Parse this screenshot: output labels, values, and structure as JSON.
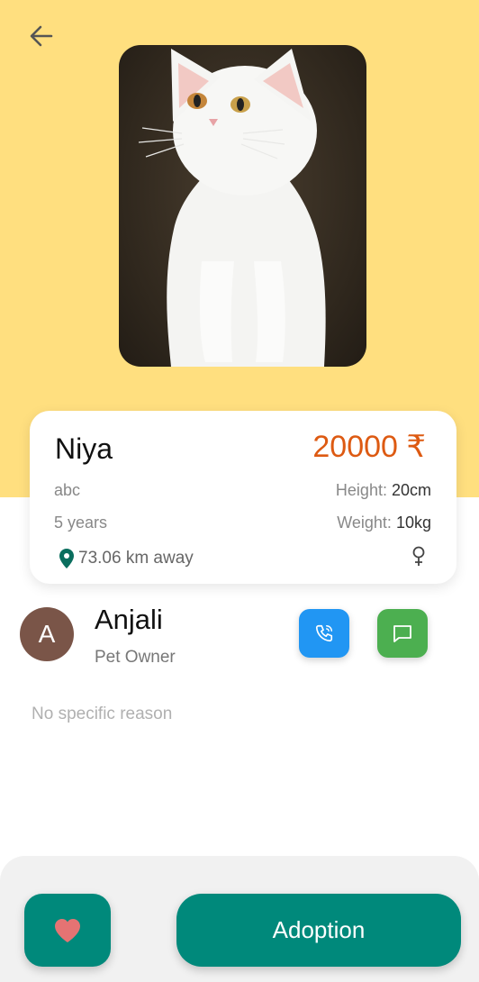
{
  "pet": {
    "name": "Niya",
    "price": "20000 ₹",
    "breed": "abc",
    "age": "5 years",
    "height_label": "Height:",
    "height_value": "20cm",
    "weight_label": "Weight:",
    "weight_value": "10kg",
    "distance": "73.06 km away",
    "gender_icon": "female-icon",
    "photo_description_icon": "white-cat-photo"
  },
  "owner": {
    "initial": "A",
    "name": "Anjali",
    "role": "Pet Owner",
    "avatar_color": "#7a5548"
  },
  "reason": "No specific reason",
  "actions": {
    "adopt_label": "Adoption",
    "favorite_icon": "heart-icon",
    "call_icon": "phone-icon",
    "chat_icon": "message-icon",
    "back_icon": "arrow-left-icon"
  },
  "colors": {
    "hero_bg": "#ffdf7f",
    "price": "#dd5a12",
    "primary": "#00897b",
    "call": "#2196f3",
    "chat": "#4caf50",
    "heart": "#e57373"
  }
}
